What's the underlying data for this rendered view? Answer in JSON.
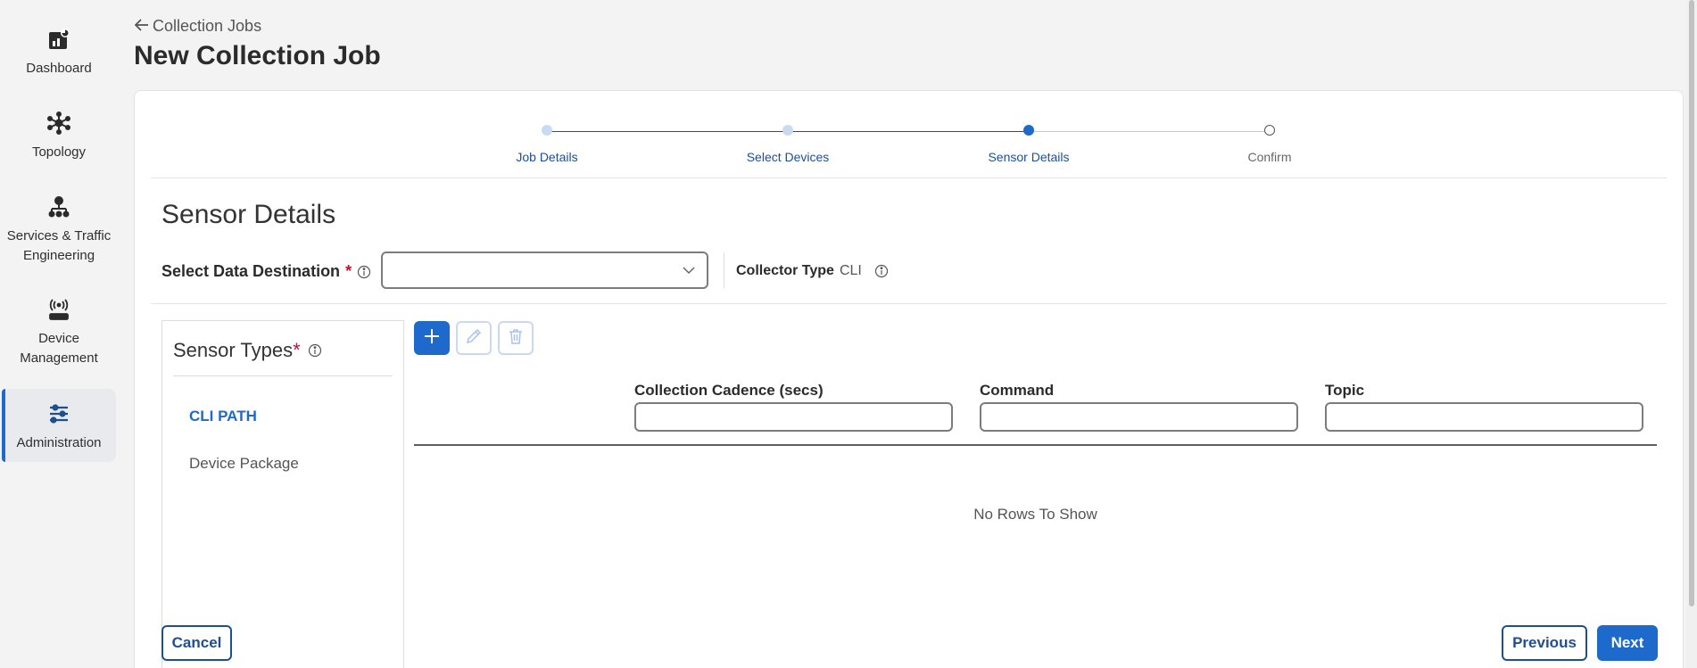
{
  "sidebar": {
    "items": [
      {
        "label": "Dashboard",
        "icon": "dashboard-icon"
      },
      {
        "label": "Topology",
        "icon": "topology-icon"
      },
      {
        "label": "Services & Traffic Engineering",
        "icon": "services-icon"
      },
      {
        "label": "Device Management",
        "icon": "device-icon"
      },
      {
        "label": "Administration",
        "icon": "admin-icon",
        "active": true
      }
    ]
  },
  "header": {
    "back_label": "Collection Jobs",
    "title": "New Collection Job"
  },
  "stepper": {
    "steps": [
      {
        "label": "Job Details",
        "state": "completed"
      },
      {
        "label": "Select Devices",
        "state": "completed"
      },
      {
        "label": "Sensor Details",
        "state": "current"
      },
      {
        "label": "Confirm",
        "state": "pending"
      }
    ]
  },
  "form": {
    "section_title": "Sensor Details",
    "destination_label": "Select Data Destination",
    "required_mark": "*",
    "destination_value": "",
    "collector_type_label": "Collector Type",
    "collector_type_value": "CLI"
  },
  "sensor_types": {
    "title": "Sensor Types",
    "required_mark": "*",
    "items": [
      {
        "label": "CLI PATH",
        "selected": true
      },
      {
        "label": "Device Package",
        "selected": false
      }
    ]
  },
  "grid": {
    "columns": [
      {
        "header": "Collection Cadence (secs)",
        "filter_value": ""
      },
      {
        "header": "Command",
        "filter_value": ""
      },
      {
        "header": "Topic",
        "filter_value": ""
      }
    ],
    "empty_message": "No Rows To Show"
  },
  "footer": {
    "cancel_label": "Cancel",
    "previous_label": "Previous",
    "next_label": "Next"
  },
  "colors": {
    "accent": "#1d69cc",
    "required": "#c8102e"
  }
}
